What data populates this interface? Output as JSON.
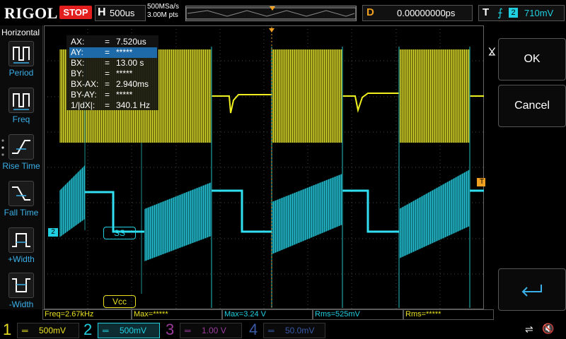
{
  "header": {
    "brand": "RIGOL",
    "run_state": "STOP",
    "timebase_letter": "H",
    "timebase_value": "500us",
    "sample_rate": "500MSa/s",
    "memory_depth": "3.00M pts",
    "delay_letter": "D",
    "delay_value": "0.00000000ps",
    "trigger_letter": "T",
    "trigger_source": "2",
    "trigger_level": "710mV"
  },
  "left_menu": {
    "title": "Horizontal",
    "items": [
      {
        "label": "Period"
      },
      {
        "label": "Freq"
      },
      {
        "label": "Rise Time"
      },
      {
        "label": "Fall Time"
      },
      {
        "label": "+Width"
      },
      {
        "label": "-Width"
      }
    ]
  },
  "right_menu": {
    "ok_label": "OK",
    "cancel_label": "Cancel"
  },
  "cursor_readout": [
    {
      "key": "AX:",
      "value": "7.520us",
      "selected": false
    },
    {
      "key": "AY:",
      "value": "*****",
      "selected": true
    },
    {
      "key": "BX:",
      "value": "13.00 s",
      "selected": false
    },
    {
      "key": "BY:",
      "value": "*****",
      "selected": false
    },
    {
      "key": "BX-AX:",
      "value": "2.940ms",
      "selected": false
    },
    {
      "key": "BY-AY:",
      "value": "*****",
      "selected": false
    },
    {
      "key": "1/|dX|:",
      "value": "340.1 Hz",
      "selected": false
    }
  ],
  "cursor_eq": "=",
  "channel_labels": {
    "ch2": "SS",
    "ch1": "Vcc",
    "ch2_marker": "2",
    "trigger_marker": "T"
  },
  "measurements": [
    {
      "text": "Freq=2.67kHz",
      "color": "#e8e020"
    },
    {
      "text": "Max=*****",
      "color": "#e8e020"
    },
    {
      "text": "Max=3.24 V",
      "color": "#20d0e0"
    },
    {
      "text": "Rms=525mV",
      "color": "#20d0e0"
    },
    {
      "text": "Rms=*****",
      "color": "#e8e020"
    }
  ],
  "channels": [
    {
      "number": "1",
      "scale": "500mV",
      "color": "#e8e020"
    },
    {
      "number": "2",
      "scale": "500mV",
      "color": "#20d0e0"
    },
    {
      "number": "3",
      "scale": "1.00 V",
      "color": "#9a3a9a"
    },
    {
      "number": "4",
      "scale": "50.0mV",
      "color": "#3a5aa8"
    }
  ],
  "icons": {
    "usb": "usb-icon",
    "mute": "speaker-mute-icon",
    "enter": "enter-icon"
  },
  "colors": {
    "ch1": "#e8e020",
    "ch2": "#20d0e0",
    "accent": "#f0a020",
    "stop": "#e21e1e"
  }
}
